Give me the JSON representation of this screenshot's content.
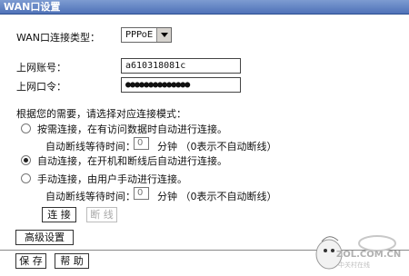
{
  "window": {
    "title": "WAN口设置"
  },
  "form": {
    "wan_type_label": "WAN口连接类型：",
    "wan_type_value": "PPPoE",
    "account_label": "上网账号：",
    "account_value": "a610318081c",
    "password_label": "上网口令：",
    "password_value": "●●●●●●●●●●●●●●"
  },
  "mode": {
    "intro": "根据您的需要，请选择对应连接模式：",
    "options": [
      {
        "label": "按需连接，在有访问数据时自动进行连接。",
        "selected": false
      },
      {
        "label": "自动连接，在开机和断线后自动进行连接。",
        "selected": true
      },
      {
        "label": "手动连接，由用户手动进行连接。",
        "selected": false
      }
    ],
    "idle_label": "自动断线等待时间：",
    "idle_value_1": "0",
    "idle_value_2": "0",
    "unit_hint": "分钟 （0表示不自动断线）"
  },
  "buttons": {
    "connect": "连 接",
    "disconnect": "断 线",
    "advanced": "高级设置",
    "save": "保 存",
    "help": "帮 助"
  },
  "watermark": {
    "text": "ZOL.COM.CN",
    "sub": "中关村在线"
  }
}
